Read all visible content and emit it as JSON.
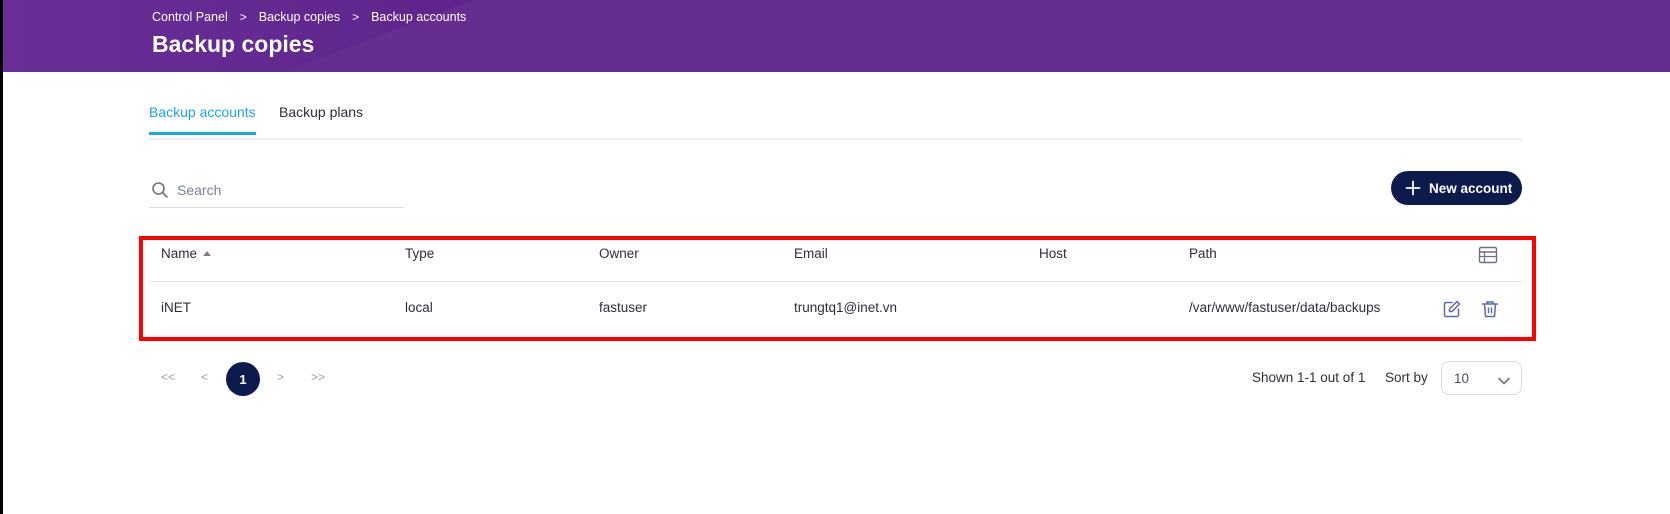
{
  "breadcrumb": {
    "items": [
      "Control Panel",
      "Backup copies",
      "Backup accounts"
    ],
    "separator": ">"
  },
  "page": {
    "title": "Backup copies"
  },
  "tabs": [
    {
      "label": "Backup accounts",
      "active": true
    },
    {
      "label": "Backup plans",
      "active": false
    }
  ],
  "search": {
    "placeholder": "Search",
    "value": ""
  },
  "actions": {
    "new_account_label": "New account"
  },
  "table": {
    "columns": [
      "Name",
      "Type",
      "Owner",
      "Email",
      "Host",
      "Path"
    ],
    "sorted_by": "Name",
    "rows": [
      {
        "name": "iNET",
        "type": "local",
        "owner": "fastuser",
        "email": "trungtq1@inet.vn",
        "host": "",
        "path": "/var/www/fastuser/data/backups"
      }
    ]
  },
  "pagination": {
    "first": "<<",
    "prev": "<",
    "current": "1",
    "next": ">",
    "last": ">>",
    "shown_text": "Shown 1-1 out of 1",
    "sort_by_label": "Sort by",
    "page_size": "10"
  },
  "colors": {
    "header_bg": "#662d91",
    "accent": "#1ba7e0",
    "primary_button": "#0d1b4c",
    "highlight_border": "#ff0000"
  },
  "icons": [
    "search-icon",
    "plus-icon",
    "sort-asc-icon",
    "table-columns-icon",
    "edit-icon",
    "trash-icon",
    "chevron-down-icon"
  ]
}
